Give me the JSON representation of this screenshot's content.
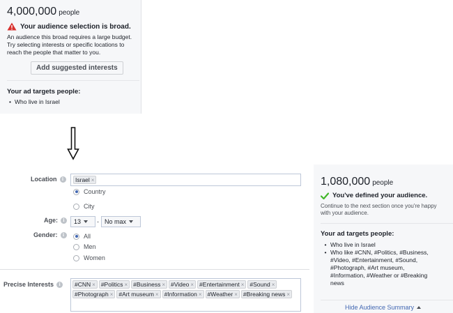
{
  "top_panel": {
    "reach_number": "4,000,000",
    "reach_unit": "people",
    "warning_title": "Your audience selection is broad.",
    "description_lines": [
      "An audience this broad requires a large budget.",
      "Try selecting interests or specific locations to",
      "reach the people that matter to you."
    ],
    "suggest_button": "Add suggested interests",
    "targets_title": "Your ad targets people:",
    "targets": [
      "Who live in Israel"
    ]
  },
  "form": {
    "location_label": "Location",
    "location_tokens": [
      "Israel"
    ],
    "location_options": [
      "Country",
      "City"
    ],
    "location_selected": "Country",
    "age_label": "Age:",
    "age_min": "13",
    "age_dash": "-",
    "age_max": "No max",
    "gender_label": "Gender:",
    "gender_options": [
      "All",
      "Men",
      "Women"
    ],
    "gender_selected": "All",
    "interests_label": "Precise Interests",
    "interest_tokens": [
      "#CNN",
      "#Politics",
      "#Business",
      "#Video",
      "#Entertainment",
      "#Sound",
      "#Photograph",
      "#Art museum",
      "#Information",
      "#Weather",
      "#Breaking news"
    ],
    "info_glyph": "i",
    "remove_glyph": "×"
  },
  "summary": {
    "reach_number": "1,080,000",
    "reach_unit": "people",
    "ok_title": "You've defined your audience.",
    "description_lines": [
      "Continue to the next section once you're happy",
      "with your audience."
    ],
    "targets_title": "Your ad targets people:",
    "targets": [
      {
        "lines": [
          "Who live in Israel"
        ]
      },
      {
        "lines": [
          "Who like #CNN, #Politics, #Business,",
          "#Video, #Entertainment, #Sound,",
          "#Photograph, #Art museum,",
          "#Information, #Weather or #Breaking",
          "news"
        ]
      }
    ],
    "hide_link": "Hide Audience Summary"
  },
  "colors": {
    "panel_bg": "#f6f7f9",
    "warning_red": "#d8312e",
    "success_green": "#42b72a",
    "link_blue": "#4267b2"
  },
  "icons": [
    "warning-icon",
    "check-icon",
    "down-arrow-icon",
    "info-icon",
    "remove-icon",
    "caret-down-icon",
    "caret-up-icon"
  ]
}
